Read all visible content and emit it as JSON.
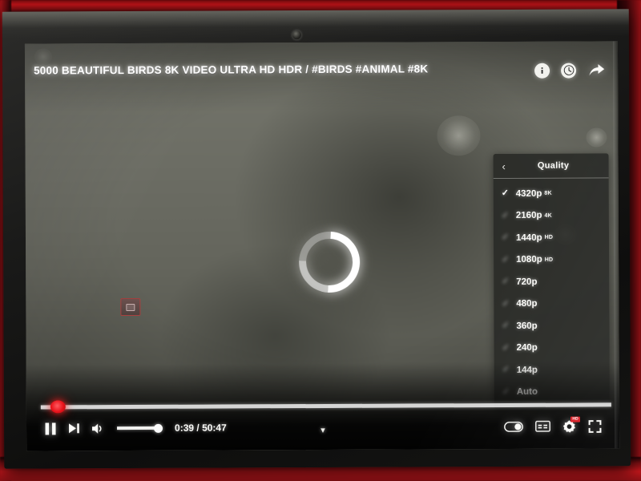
{
  "player": {
    "title": "5000 BEAUTIFUL BIRDS 8K VIDEO ULTRA HD HDR / #BIRDS #ANIMAL #8K",
    "state": "buffering",
    "loading_spinner": "loading-spinner",
    "top_actions": [
      {
        "name": "info-icon",
        "label": "i"
      },
      {
        "name": "watch-later-icon",
        "label": "clock"
      },
      {
        "name": "share-icon",
        "label": "share"
      }
    ],
    "controls": {
      "play_pause": "pause",
      "next": "next-video",
      "volume_icon": "volume-on",
      "volume_level": 100,
      "current_time": "0:39",
      "duration": "50:47",
      "time_display": "0:39 / 50:47",
      "progress_percent": 1.3,
      "expand_chevron": "chevron-down",
      "autoplay_label": "autoplay",
      "subtitles_label": "CC",
      "settings_label": "settings",
      "settings_badge": "HD",
      "fullscreen_label": "fullscreen"
    }
  },
  "quality_menu": {
    "back_label": "‹",
    "title": "Quality",
    "selected": "4320p",
    "items": [
      {
        "label": "4320p",
        "sup": "8K",
        "checked": true
      },
      {
        "label": "2160p",
        "sup": "4K",
        "checked": false
      },
      {
        "label": "1440p",
        "sup": "HD",
        "checked": false
      },
      {
        "label": "1080p",
        "sup": "HD",
        "checked": false
      },
      {
        "label": "720p",
        "sup": "",
        "checked": false
      },
      {
        "label": "480p",
        "sup": "",
        "checked": false
      },
      {
        "label": "360p",
        "sup": "",
        "checked": false
      },
      {
        "label": "240p",
        "sup": "",
        "checked": false
      },
      {
        "label": "144p",
        "sup": "",
        "checked": false
      },
      {
        "label": "Auto",
        "sup": "",
        "checked": false
      }
    ]
  },
  "colors": {
    "accent_red": "#e8121a",
    "menu_bg": "#282926",
    "text": "#fbfbf8",
    "surface_red": "#c4171c"
  }
}
